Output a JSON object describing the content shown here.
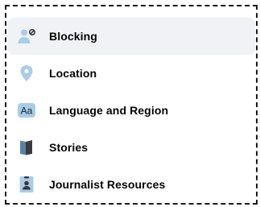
{
  "menu": {
    "items": [
      {
        "label": "Blocking",
        "icon": "user-block-icon",
        "active": true
      },
      {
        "label": "Location",
        "icon": "location-pin-icon"
      },
      {
        "label": "Language and Region",
        "icon": "aa-text-icon",
        "icon_text": "Aa"
      },
      {
        "label": "Stories",
        "icon": "book-icon"
      },
      {
        "label": "Journalist Resources",
        "icon": "id-badge-icon"
      }
    ]
  },
  "colors": {
    "active_bg": "#f0f2f5",
    "icon_blue": "#a8cde9",
    "icon_dark": "#3a3b3c",
    "text": "#050505"
  }
}
